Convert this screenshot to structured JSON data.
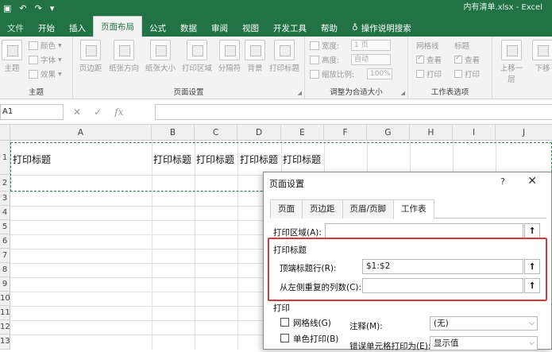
{
  "window": {
    "title": "内有清单.xlsx - Excel"
  },
  "ribbon": {
    "tabs": [
      {
        "label": "文件"
      },
      {
        "label": "开始"
      },
      {
        "label": "插入"
      },
      {
        "label": "页面布局"
      },
      {
        "label": "公式"
      },
      {
        "label": "数据"
      },
      {
        "label": "审阅"
      },
      {
        "label": "视图"
      },
      {
        "label": "开发工具"
      },
      {
        "label": "帮助"
      }
    ],
    "active_tab": "页面布局",
    "tell_me": "操作说明搜索",
    "groups": {
      "theme": {
        "label": "主题",
        "main_button": "主题",
        "colors": "颜色",
        "fonts": "字体",
        "effects": "效果"
      },
      "page_setup": {
        "label": "页面设置",
        "buttons": [
          "页边距",
          "纸张方向",
          "纸张大小",
          "打印区域",
          "分隔符",
          "背景",
          "打印标题"
        ]
      },
      "scale": {
        "label": "调整为合适大小",
        "width_label": "宽度:",
        "width_value": "1 页",
        "height_label": "高度:",
        "height_value": "自动",
        "scale_label": "缩放比例:",
        "scale_value": "100%"
      },
      "sheet_options": {
        "label": "工作表选项",
        "gridlines": "网格线",
        "headings": "标题",
        "view": "查看",
        "print": "打印"
      },
      "arrange": {
        "bring_forward": "上移一层",
        "send_backward": "下移"
      }
    }
  },
  "formula_bar": {
    "name_box": "A1",
    "cancel": "✕",
    "enter": "✓",
    "fx": "fx",
    "formula": ""
  },
  "grid": {
    "columns": [
      "A",
      "B",
      "C",
      "D",
      "E",
      "F",
      "G",
      "H",
      "I",
      "J"
    ],
    "rows": [
      "1",
      "2",
      "3",
      "4",
      "5",
      "6",
      "7",
      "8",
      "9",
      "10",
      "11",
      "12",
      "13"
    ],
    "row1_cells": [
      "打印标题",
      "打印标题",
      "打印标题",
      "打印标题",
      "打印标题"
    ]
  },
  "dialog": {
    "title": "页面设置",
    "help": "?",
    "close": "✕",
    "tabs": [
      "页面",
      "页边距",
      "页眉/页脚",
      "工作表"
    ],
    "active_tab": "工作表",
    "print_area_label": "打印区域(A):",
    "print_area_value": "",
    "print_titles_section": "打印标题",
    "top_rows_label": "顶端标题行(R):",
    "top_rows_value": "$1:$2",
    "left_cols_label": "从左侧重复的列数(C):",
    "left_cols_value": "",
    "print_section": "打印",
    "gridlines_label": "网格线(G)",
    "mono_label": "单色打印(B)",
    "comments_label": "注释(M):",
    "comments_value": "(无)",
    "errors_label": "错误单元格打印为(E):",
    "errors_value": "显示值",
    "ref_icon": "⭡"
  },
  "colors": {
    "excel_green": "#217346",
    "highlight_red": "#d9363e"
  }
}
